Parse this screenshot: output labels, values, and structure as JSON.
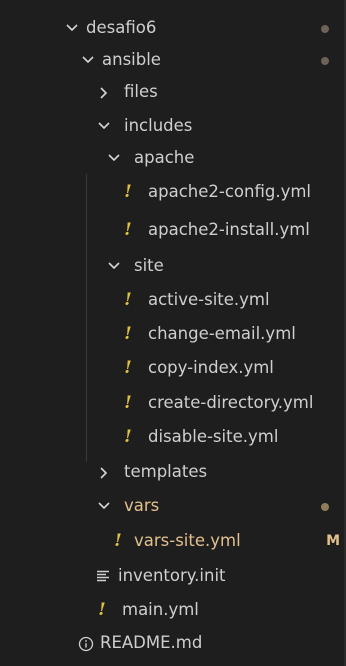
{
  "colors": {
    "background": "#1e1e1e",
    "text": "#cfcfcf",
    "yaml_icon": "#e2c33f",
    "modified": "#e2c08d",
    "dot": "#6e6258"
  },
  "icons": {
    "expanded": "chevron-down-icon",
    "collapsed": "chevron-right-icon",
    "yaml": "exclamation-icon",
    "text_file": "lines-icon",
    "info": "info-icon"
  },
  "tree": [
    {
      "label": "desafio6",
      "kind": "folder",
      "expanded": true,
      "badge": "dot"
    },
    {
      "label": "ansible",
      "kind": "folder",
      "expanded": true,
      "badge": "dot"
    },
    {
      "label": "files",
      "kind": "folder",
      "expanded": false
    },
    {
      "label": "includes",
      "kind": "folder",
      "expanded": true
    },
    {
      "label": "apache",
      "kind": "folder",
      "expanded": true
    },
    {
      "label": "apache2-config.yml",
      "kind": "yaml"
    },
    {
      "label": "apache2-install.yml",
      "kind": "yaml"
    },
    {
      "label": "site",
      "kind": "folder",
      "expanded": true
    },
    {
      "label": "active-site.yml",
      "kind": "yaml"
    },
    {
      "label": "change-email.yml",
      "kind": "yaml"
    },
    {
      "label": "copy-index.yml",
      "kind": "yaml"
    },
    {
      "label": "create-directory.yml",
      "kind": "yaml"
    },
    {
      "label": "disable-site.yml",
      "kind": "yaml"
    },
    {
      "label": "templates",
      "kind": "folder",
      "expanded": false
    },
    {
      "label": "vars",
      "kind": "folder",
      "expanded": true,
      "modified": true,
      "badge": "dot"
    },
    {
      "label": "vars-site.yml",
      "kind": "yaml",
      "modified": true,
      "git_status": "M"
    },
    {
      "label": "inventory.init",
      "kind": "text"
    },
    {
      "label": "main.yml",
      "kind": "yaml"
    },
    {
      "label": "README.md",
      "kind": "info"
    }
  ]
}
